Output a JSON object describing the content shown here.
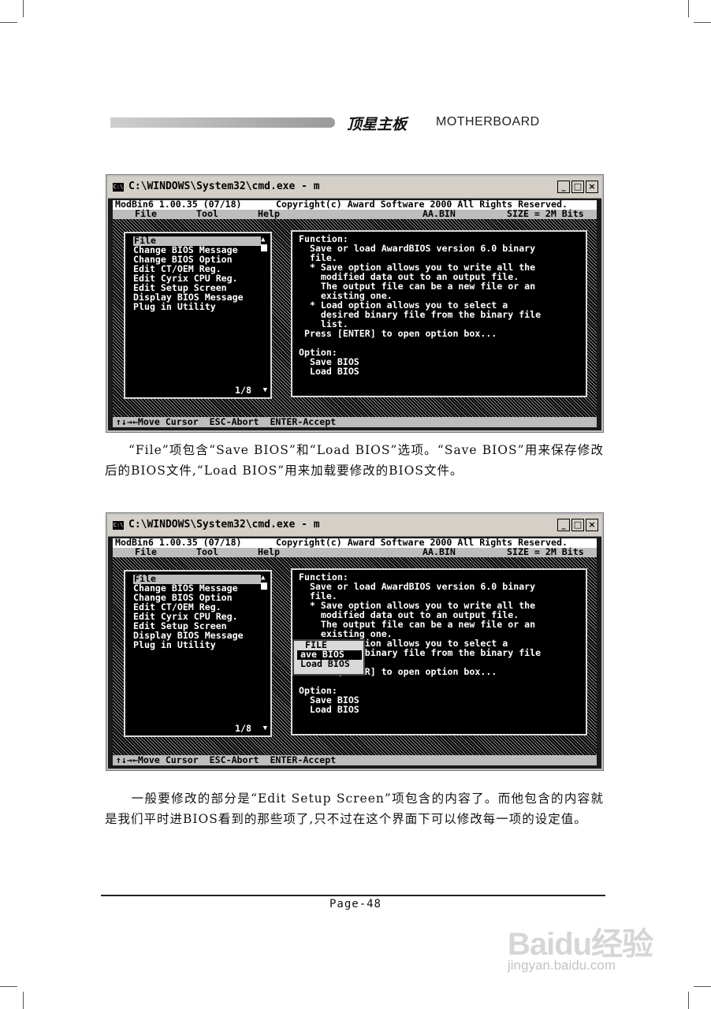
{
  "header": {
    "brand_cn": "顶星主板",
    "brand_en": "MOTHERBOARD"
  },
  "window": {
    "title": "C:\\WINDOWS\\System32\\cmd.exe - m",
    "icon_text": "C:\\",
    "buttons": {
      "minimize": "_",
      "maximize": "□",
      "close": "×"
    }
  },
  "console": {
    "app_line": "ModBin6 1.00.35 (07/18)",
    "copyright": "Copyright(c) Award Software 2000 All Rights Reserved.",
    "menus": [
      "File",
      "Tool",
      "Help"
    ],
    "filename": "AA.BIN",
    "size": "SIZE = 2M Bits",
    "menu_items": [
      "File",
      "Change BIOS Message",
      "Change BIOS Option",
      "Edit CT/OEM Reg.",
      "Edit Cyrix CPU Reg.",
      "Edit Setup Screen",
      "Display BIOS Message",
      "Plug in Utility"
    ],
    "page_indicator": "1/8",
    "function_lines": [
      "Function:",
      "  Save or load AwardBIOS version 6.0 binary",
      "  file.",
      "  * Save option allows you to write all the",
      "    modified data out to an output file.",
      "    The output file can be a new file or an",
      "    existing one.",
      "  * Load option allows you to select a",
      "    desired binary file from the binary file",
      "    list.",
      " Press [ENTER] to open option box...",
      "",
      "Option:",
      "  Save BIOS",
      "  Load BIOS"
    ],
    "status_bar": "↑↓→←Move Cursor  ESC-Abort  ENTER-Accept"
  },
  "popup": {
    "title": "FILE",
    "options": [
      "ave BIOS",
      "Load BIOS"
    ]
  },
  "paragraphs": {
    "p1": "“File”项包含“Save BIOS”和“Load BIOS”选项。“Save BIOS”用来保存修改后的BIOS文件,“Load BIOS”用来加载要修改的BIOS文件。",
    "p2": "　　一般要修改的部分是“Edit Setup Screen”项包含的内容了。而他包含的内容就是我们平时进BIOS看到的那些项了,只不过在这个界面下可以修改每一项的设定值。"
  },
  "footer": {
    "page": "Page-48"
  },
  "watermark": {
    "logo": "Baidu经验",
    "url": "jingyan.baidu.com"
  }
}
